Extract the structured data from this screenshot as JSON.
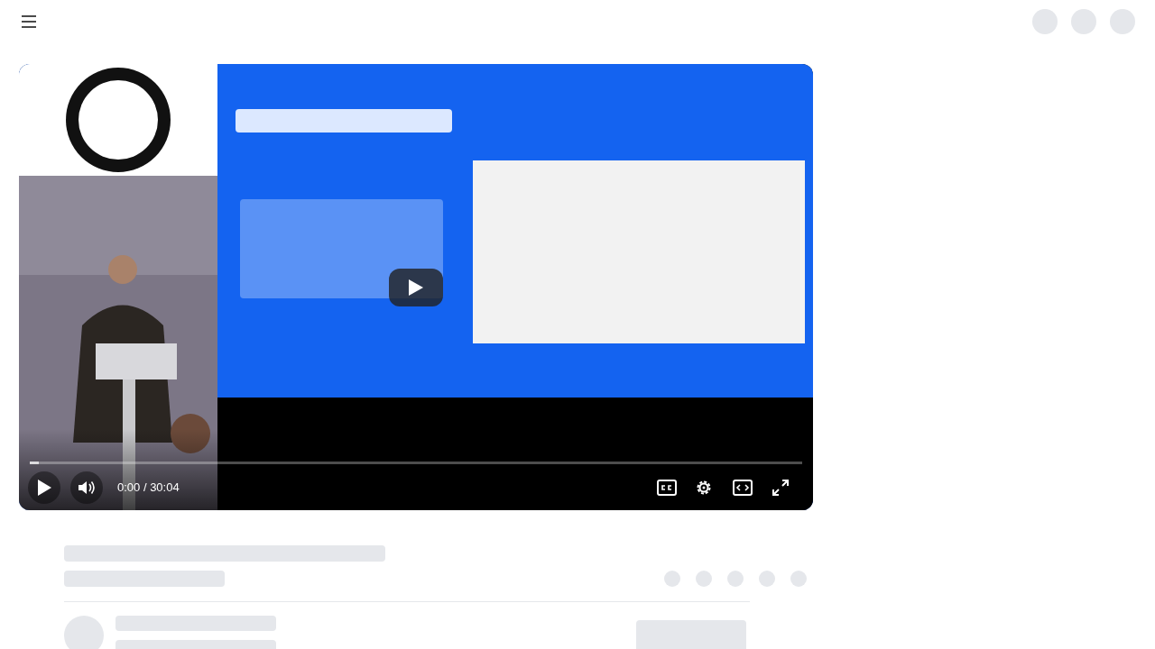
{
  "player": {
    "time": "0:00 / 30:04",
    "progress": {
      "level": 0.012
    },
    "paused": true
  }
}
